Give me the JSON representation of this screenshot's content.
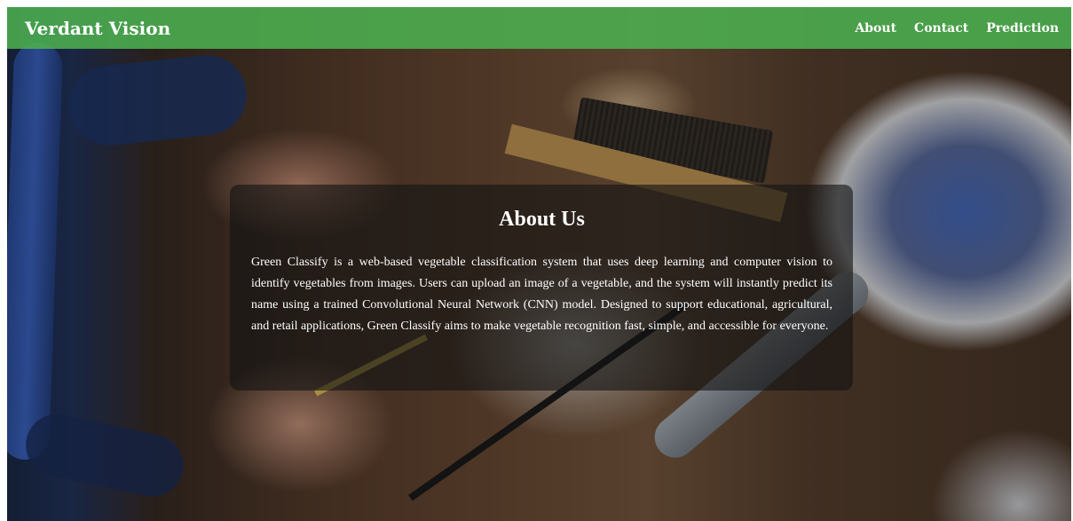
{
  "navbar": {
    "brand": "Verdant Vision",
    "links": [
      {
        "label": "About"
      },
      {
        "label": "Contact"
      },
      {
        "label": "Prediction"
      }
    ],
    "background_color": "#4CAF50"
  },
  "about": {
    "title": "About Us",
    "body": "Green Classify is a web-based vegetable classification system that uses deep learning and computer vision to identify vegetables from images. Users can upload an image of a vegetable, and the system will instantly predict its name using a trained Convolutional Neural Network (CNN) model. Designed to support educational, agricultural, and retail applications, Green Classify aims to make vegetable recognition fast, simple, and accessible for everyone."
  }
}
